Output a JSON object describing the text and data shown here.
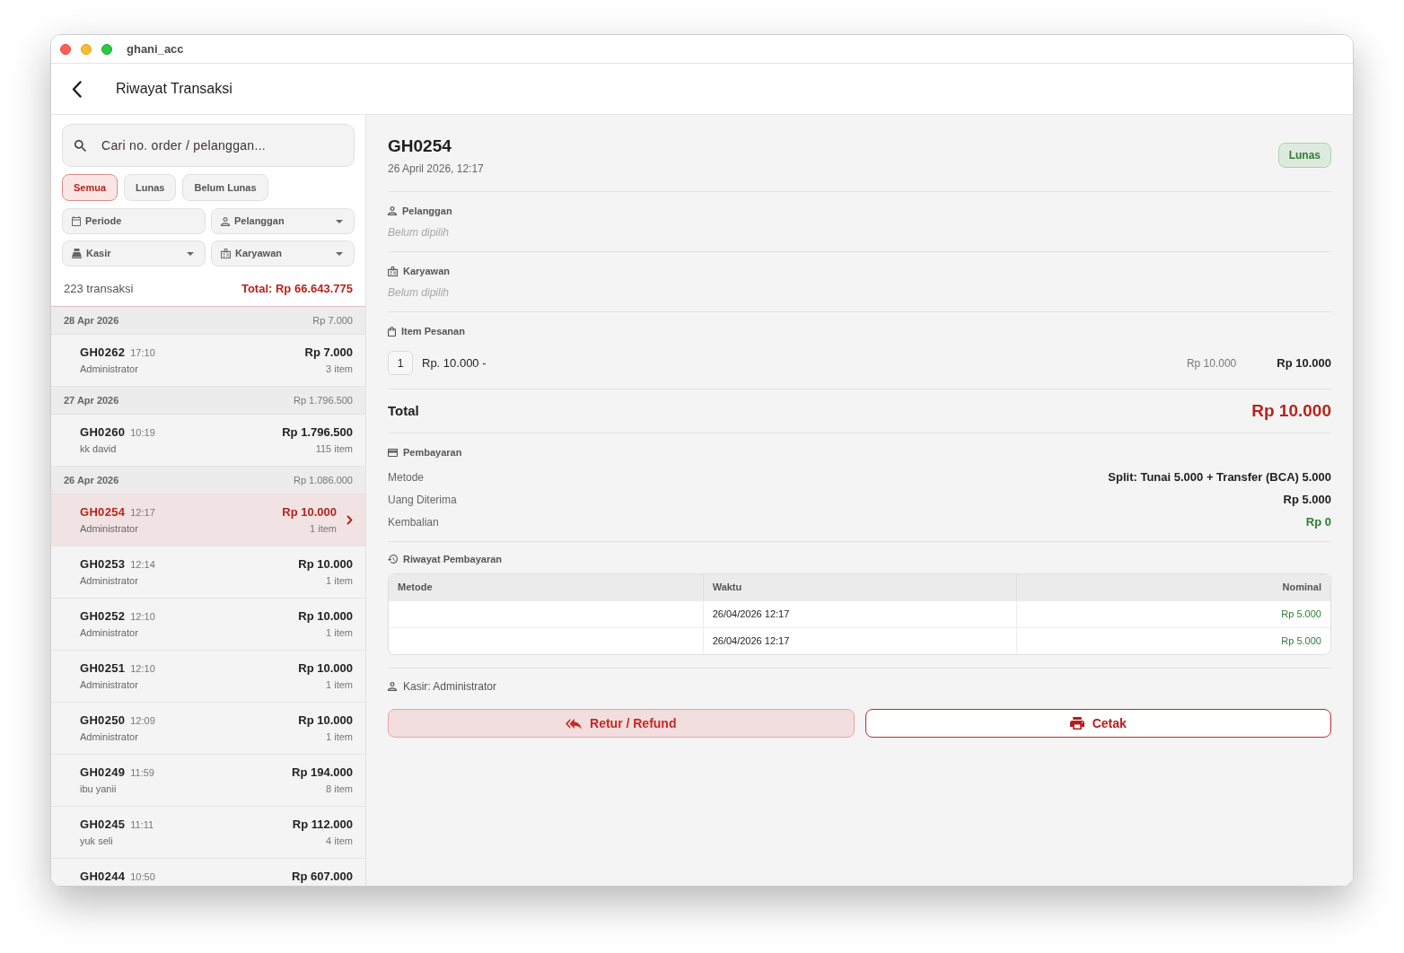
{
  "window": {
    "title": "ghani_acc"
  },
  "app_bar": {
    "title": "Riwayat Transaksi"
  },
  "sidebar": {
    "search": {
      "placeholder": "Cari no. order / pelanggan..."
    },
    "status_filters": [
      {
        "label": "Semua",
        "selected": true
      },
      {
        "label": "Lunas",
        "selected": false
      },
      {
        "label": "Belum Lunas",
        "selected": false
      }
    ],
    "filters": [
      {
        "label": "Periode",
        "kind": "picker"
      },
      {
        "label": "Pelanggan",
        "kind": "dropdown"
      },
      {
        "label": "Kasir",
        "kind": "dropdown"
      },
      {
        "label": "Karyawan",
        "kind": "dropdown"
      }
    ],
    "summary": {
      "count": "223 transaksi",
      "total": "Total: Rp 66.643.775"
    },
    "groups": [
      {
        "date": "28 Apr 2026",
        "total": "Rp 7.000",
        "transactions": [
          {
            "id": "GH0262",
            "time": "17:10",
            "name": "Administrator",
            "amount": "Rp 7.000",
            "items": "3 item",
            "selected": false
          }
        ]
      },
      {
        "date": "27 Apr 2026",
        "total": "Rp 1.796.500",
        "transactions": [
          {
            "id": "GH0260",
            "time": "10:19",
            "name": "kk david",
            "amount": "Rp 1.796.500",
            "items": "115 item",
            "selected": false
          }
        ]
      },
      {
        "date": "26 Apr 2026",
        "total": "Rp 1.086.000",
        "transactions": [
          {
            "id": "GH0254",
            "time": "12:17",
            "name": "Administrator",
            "amount": "Rp 10.000",
            "items": "1 item",
            "selected": true
          },
          {
            "id": "GH0253",
            "time": "12:14",
            "name": "Administrator",
            "amount": "Rp 10.000",
            "items": "1 item",
            "selected": false
          },
          {
            "id": "GH0252",
            "time": "12:10",
            "name": "Administrator",
            "amount": "Rp 10.000",
            "items": "1 item",
            "selected": false
          },
          {
            "id": "GH0251",
            "time": "12:10",
            "name": "Administrator",
            "amount": "Rp 10.000",
            "items": "1 item",
            "selected": false
          },
          {
            "id": "GH0250",
            "time": "12:09",
            "name": "Administrator",
            "amount": "Rp 10.000",
            "items": "1 item",
            "selected": false
          },
          {
            "id": "GH0249",
            "time": "11:59",
            "name": "ibu yanii",
            "amount": "Rp 194.000",
            "items": "8 item",
            "selected": false
          },
          {
            "id": "GH0245",
            "time": "11:11",
            "name": "yuk seli",
            "amount": "Rp 112.000",
            "items": "4 item",
            "selected": false
          },
          {
            "id": "GH0244",
            "time": "10:50",
            "amount": "Rp 607.000",
            "selected": false
          }
        ]
      }
    ]
  },
  "detail": {
    "order_no": "GH0254",
    "datetime": "26 April 2026, 12:17",
    "status": {
      "label": "Lunas",
      "kind": "paid"
    },
    "customer": {
      "label": "Pelanggan",
      "value": "Belum dipilih"
    },
    "employee": {
      "label": "Karyawan",
      "value": "Belum dipilih"
    },
    "order_items": {
      "label": "Item Pesanan",
      "rows": [
        {
          "qty": "1",
          "name": "Rp. 10.000 -",
          "price": "Rp 10.000",
          "subtotal": "Rp 10.000"
        }
      ]
    },
    "total": {
      "label": "Total",
      "value": "Rp 10.000"
    },
    "payment": {
      "label": "Pembayaran",
      "rows": [
        {
          "label": "Metode",
          "value": "Split: Tunai 5.000 + Transfer (BCA) 5.000",
          "kind": "plain"
        },
        {
          "label": "Uang Diterima",
          "value": "Rp 5.000",
          "kind": "plain"
        },
        {
          "label": "Kembalian",
          "value": "Rp 0",
          "kind": "positive"
        }
      ]
    },
    "payment_history": {
      "label": "Riwayat Pembayaran",
      "columns": [
        "Metode",
        "Waktu",
        "Nominal"
      ],
      "rows": [
        {
          "time": "26/04/2026 12:17",
          "amount": "Rp 5.000"
        },
        {
          "time": "26/04/2026 12:17",
          "amount": "Rp 5.000"
        }
      ]
    },
    "cashier": "Kasir: Administrator",
    "actions": [
      {
        "label": "Retur / Refund",
        "kind": "tonal"
      },
      {
        "label": "Cetak",
        "kind": "outlined"
      }
    ]
  }
}
